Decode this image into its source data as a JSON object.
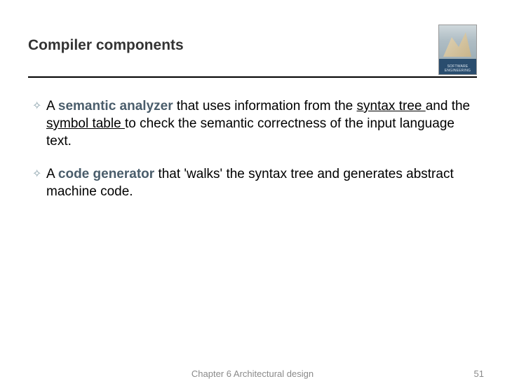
{
  "header": {
    "title": "Compiler components",
    "book_label": "SOFTWARE ENGINEERING"
  },
  "bullets": [
    {
      "prefix": "A ",
      "term": "semantic analyzer",
      "mid1": " that uses information from the ",
      "u1": "syntax tree ",
      "mid2": "and the ",
      "u2": "symbol table ",
      "tail": "to check the semantic correctness of the input language text."
    },
    {
      "prefix": "A ",
      "term": "code generator",
      "mid1": " that 'walks' the syntax tree and generates abstract machine code.",
      "u1": "",
      "mid2": "",
      "u2": "",
      "tail": ""
    }
  ],
  "footer": {
    "center": "Chapter 6 Architectural design",
    "page": "51"
  }
}
